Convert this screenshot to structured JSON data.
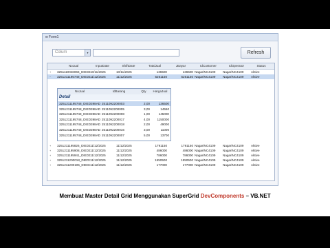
{
  "window": {
    "title": "w Form1"
  },
  "toolbar": {
    "column_placeholder": "Colum",
    "combo_arrow": "▾",
    "refresh_label": "Refresh"
  },
  "grid": {
    "headers": [
      "NoJual",
      "InputDate",
      "ShiftDate",
      "TotalJual",
      "JBayar",
      "IdCustomer",
      "IdOperator",
      "Status"
    ],
    "rows_top": [
      [
        "3251110046066_DIED398AD",
        "10/11/2025",
        "10/11/2025",
        "136500",
        "136500",
        "NagariNC4109",
        "NagariNC4109",
        "Aktive"
      ],
      [
        "3251211195748_DIED398AD",
        "11/12/2025",
        "11/12/2025",
        "5261150",
        "5261150",
        "NagariNC4109",
        "NagariNC4109",
        "Aktive"
      ]
    ],
    "rows_bottom": [
      [
        "3251211195826_DIED398AD",
        "11/12/2025",
        "11/12/2025",
        "1791150",
        "1791150",
        "NagariNC4109",
        "NagariNC4109",
        "Aktive"
      ],
      [
        "3251211195908_DIED398AD",
        "11/12/2025",
        "11/12/2025",
        "486000",
        "486000",
        "NagariNC4109",
        "NagariNC4109",
        "Aktive"
      ],
      [
        "3251211195941_DIED398AD",
        "11/12/2025",
        "11/12/2025",
        "786000",
        "786000",
        "NagariNC4109",
        "NagariNC4109",
        "Aktive"
      ],
      [
        "3251211200018_DIED398AD",
        "11/12/2025",
        "11/12/2025",
        "1550500",
        "1550500",
        "NagariNC4109",
        "NagariNC4109",
        "Aktive"
      ],
      [
        "3251211200105_DIED398AD",
        "11/12/2025",
        "11/12/2025",
        "177000",
        "177000",
        "NagariNC4109",
        "NagariNC4109",
        "Aktive"
      ]
    ]
  },
  "detail": {
    "title": "Detail",
    "headers": [
      "NoJual",
      "IdBarang",
      "Qty",
      "HargaJual"
    ],
    "rows": [
      [
        "3251211195748_DIED398AD",
        "2511092200003",
        "2,00",
        "136500"
      ],
      [
        "3251211195748_DIED398AD",
        "2511092200005",
        "3,00",
        "14550"
      ],
      [
        "3251211195748_DIED398AD",
        "2511092200008",
        "1,00",
        "145000"
      ],
      [
        "3251211195748_DIED398AD",
        "2511092200017",
        "4,00",
        "1150000"
      ],
      [
        "3251211195748_DIED398AD",
        "2511092200018",
        "2,00",
        "49000"
      ],
      [
        "3251211195748_DIED398AD",
        "2511092200016",
        "3,00",
        "11000"
      ],
      [
        "3251211195748_DIED398AD",
        "2511092200007",
        "5,00",
        "13700"
      ]
    ]
  },
  "caption": {
    "part1": "Membuat Master Detail Grid Menggunakan SuperGrid ",
    "part2": "DevComponents",
    "part3": " – VB.NET"
  }
}
